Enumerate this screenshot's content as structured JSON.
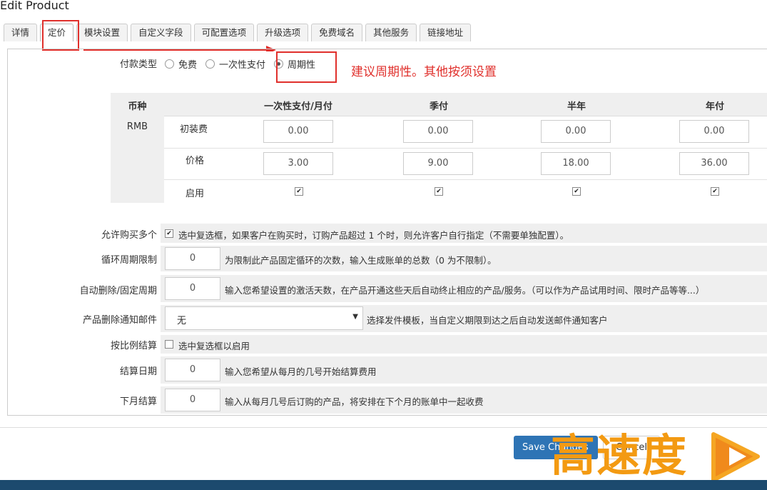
{
  "page": {
    "title": "Edit Product"
  },
  "tabs": [
    "详情",
    "定价",
    "模块设置",
    "自定义字段",
    "可配置选项",
    "升级选项",
    "免费域名",
    "其他服务",
    "链接地址"
  ],
  "payment_type": {
    "label": "付款类型",
    "options": [
      "免费",
      "一次性支付",
      "周期性"
    ],
    "selected": "周期性"
  },
  "annotation": {
    "text": "建议周期性。其他按须设置",
    "color": "#e0302c"
  },
  "pricing": {
    "currency_header": "币种",
    "currency": "RMB",
    "columns": [
      "一次性支付/月付",
      "季付",
      "半年",
      "年付"
    ],
    "setup_label": "初装费",
    "setup_values": [
      "0.00",
      "0.00",
      "0.00",
      "0.00"
    ],
    "price_label": "价格",
    "price_values": [
      "3.00",
      "9.00",
      "18.00",
      "36.00"
    ],
    "enable_label": "启用",
    "enabled": [
      true,
      true,
      true,
      true
    ]
  },
  "settings": {
    "allow_multiple": {
      "label": "允许购买多个",
      "checked": true,
      "desc": "选中复选框，如果客户在购买时，订购产品超过 1 个时，则允许客户自行指定（不需要单独配置）。"
    },
    "recurring_limit": {
      "label": "循环周期限制",
      "value": "0",
      "desc": "为限制此产品固定循环的次数，输入生成账单的总数（0 为不限制）。"
    },
    "auto_terminate": {
      "label": "自动删除/固定周期",
      "value": "0",
      "desc": "输入您希望设置的激活天数，在产品开通这些天后自动终止相应的产品/服务。（可以作为产品试用时间、限时产品等等...）"
    },
    "termination_email": {
      "label": "产品删除通知邮件",
      "value": "无",
      "desc": "选择发件模板，当自定义期限到达之后自动发送邮件通知客户"
    },
    "prorata": {
      "label": "按比例结算",
      "checked": false,
      "desc": "选中复选框以启用"
    },
    "prorata_date": {
      "label": "结算日期",
      "value": "0",
      "desc": "输入您希望从每月的几号开始结算费用"
    },
    "charge_next_month": {
      "label": "下月结算",
      "value": "0",
      "desc": "输入从每月几号后订购的产品，将安排在下个月的账单中一起收费"
    }
  },
  "buttons": {
    "save": "Save Changes",
    "cancel": "Cancel"
  },
  "watermark": {
    "text": "高速度"
  }
}
